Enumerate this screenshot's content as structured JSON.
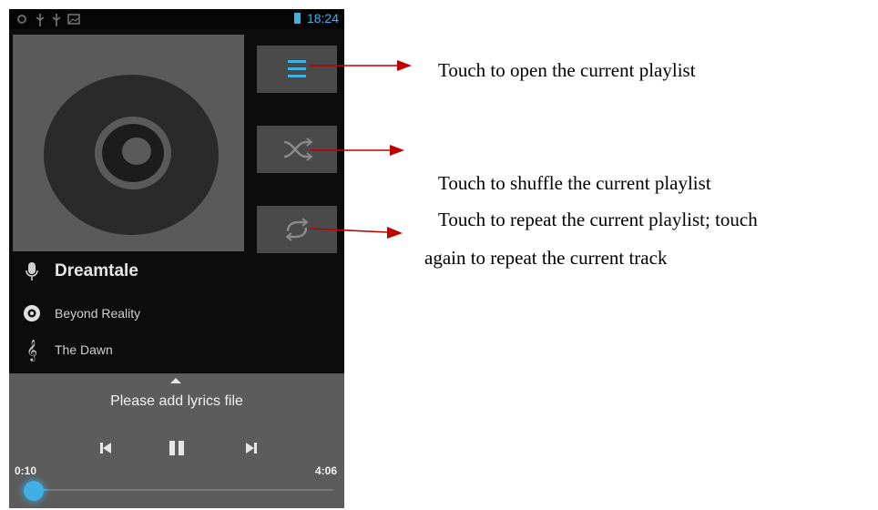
{
  "status_bar": {
    "time": "18:24",
    "icons": [
      "settings-icon",
      "usb-icon",
      "usb-icon",
      "image-icon",
      "battery-icon"
    ],
    "accent": "#3fb0e6"
  },
  "album_art": {
    "icon": "disc-icon"
  },
  "buttons": {
    "playlist_icon": "playlist-icon",
    "shuffle_icon": "shuffle-icon",
    "repeat_icon": "repeat-icon"
  },
  "track_info": {
    "artist": "Dreamtale",
    "album": "Beyond Reality",
    "title": "The Dawn"
  },
  "player": {
    "lyrics_text": "Please add lyrics file",
    "elapsed": "0:10",
    "duration": "4:06",
    "progress_fraction": 0.04
  },
  "annotations": {
    "playlist": "Touch to open the current playlist",
    "shuffle": "Touch to shuffle the current playlist",
    "repeat_line1": "Touch to repeat the current playlist; touch",
    "repeat_line2": "again to repeat the current track"
  },
  "colors": {
    "arrow": "#c00000",
    "panel": "#5c5c5c",
    "progress": "#3fb0e6"
  }
}
